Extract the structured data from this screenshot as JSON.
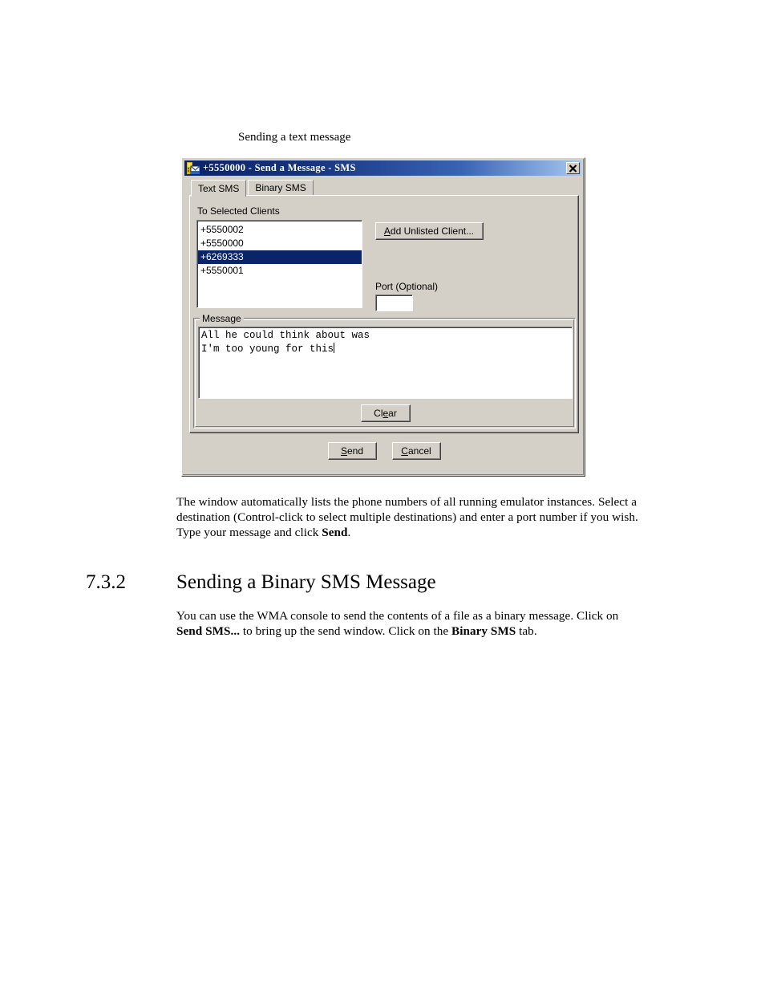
{
  "document": {
    "figure_caption": "Sending a text message",
    "paragraph_after_figure": {
      "segments": [
        {
          "text": "The window automatically lists the phone numbers of all running emulator instances. Select a destination (Control-click to select multiple destinations) and enter a port number if you wish. Type your message and click ",
          "bold": false
        },
        {
          "text": "Send",
          "bold": true
        },
        {
          "text": ".",
          "bold": false
        }
      ]
    },
    "section": {
      "number": "7.3.2",
      "title": "Sending a Binary SMS Message"
    },
    "paragraph_binary": {
      "segments": [
        {
          "text": "You can use the WMA console to send the contents of a file as a binary message. Click on ",
          "bold": false
        },
        {
          "text": "Send SMS...",
          "bold": true
        },
        {
          "text": " to bring up the send window. Click on the ",
          "bold": false
        },
        {
          "text": "Binary SMS",
          "bold": true
        },
        {
          "text": " tab.",
          "bold": false
        }
      ]
    }
  },
  "dialog": {
    "titlebar": {
      "icon": "phone-message-icon",
      "title": "+5550000 - Send a Message - SMS",
      "close_icon": "close-icon",
      "gradient_start": "#0a246a",
      "gradient_end": "#a6c8f0"
    },
    "tabs": [
      {
        "label": "Text SMS",
        "active": true
      },
      {
        "label": "Binary SMS",
        "active": false
      }
    ],
    "recipients": {
      "label": "To Selected Clients",
      "items": [
        {
          "value": "+5550002",
          "selected": false
        },
        {
          "value": "+5550000",
          "selected": false
        },
        {
          "value": "+6269333",
          "selected": true
        },
        {
          "value": "+5550001",
          "selected": false
        }
      ],
      "selection_color": "#0a246a"
    },
    "add_unlisted_button": {
      "label_before": "A",
      "label_mnemonic": "A",
      "label": "Add Unlisted Client...",
      "mnemonic_index": 0
    },
    "port": {
      "label": "Port (Optional)",
      "value": "",
      "placeholder": ""
    },
    "message": {
      "group_title": "Message",
      "value": "All he could think about was\nI'm too young for this",
      "line1": "All he could think about was",
      "line2": "I'm too young for this",
      "clear_button": {
        "label": "Clear",
        "mnemonic_index": 2
      }
    },
    "footer_buttons": [
      {
        "label": "Send",
        "mnemonic_index": 0
      },
      {
        "label": "Cancel",
        "mnemonic_index": 0
      }
    ],
    "colors": {
      "face": "#d4d0c8",
      "shadow": "#808080",
      "dark_shadow": "#404040",
      "highlight": "#ffffff",
      "field": "#ffffff"
    }
  }
}
